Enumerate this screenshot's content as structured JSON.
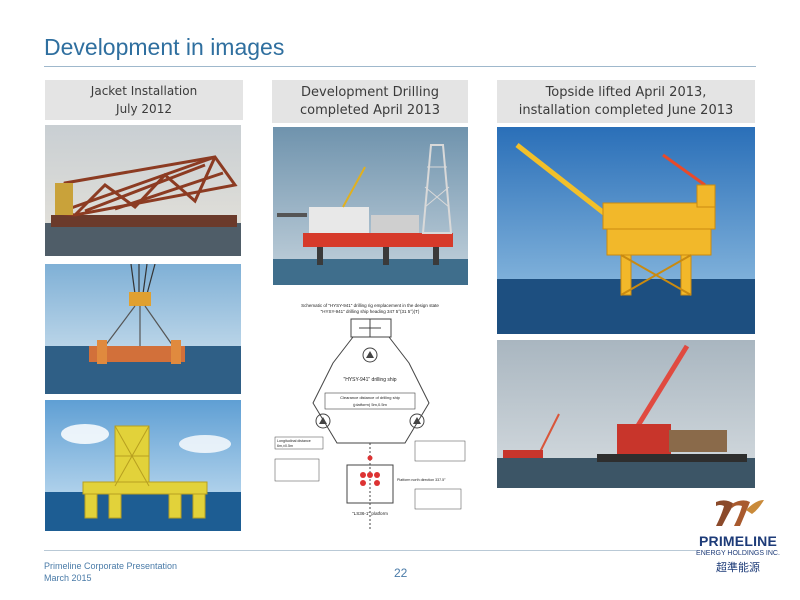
{
  "slide": {
    "title": "Development in images"
  },
  "captions": {
    "jacket": {
      "line1": "Jacket Installation",
      "line2": "July 2012"
    },
    "drilling": {
      "line1": "Development Drilling",
      "line2": "completed April 2013"
    },
    "topside": {
      "line1": "Topside lifted April 2013,",
      "line2": "installation completed June 2013"
    }
  },
  "schematic": {
    "heading_line1": "Schematic of \"HYSY-941\" drilling rig emplacement in the design state",
    "heading_line2": "\"HYSY-941\" drilling ship heading 347 5°(31 5°)(T)",
    "rig_label": "\"HYSY-941\" drilling ship",
    "clearance_label_1": "Clearance distance of drilling ship",
    "clearance_label_2": "(platform) 5m,0.5m",
    "leg_label_1": "Longitudinal distance",
    "leg_label_2": "6m,±0.5m",
    "platform_label": "\"LS36-1\" platform",
    "north_label": "Platform north direction 337.5°"
  },
  "footer": {
    "line1": "Primeline Corporate Presentation",
    "line2": "March 2015",
    "page_number": "22"
  },
  "logo": {
    "name": "PRIMELINE",
    "subtitle": "ENERGY HOLDINGS INC.",
    "chinese": "超準能源"
  },
  "colors": {
    "title": "#2f6f9f",
    "caption_bg": "#e4e4e4",
    "logo": "#1d3b78"
  }
}
